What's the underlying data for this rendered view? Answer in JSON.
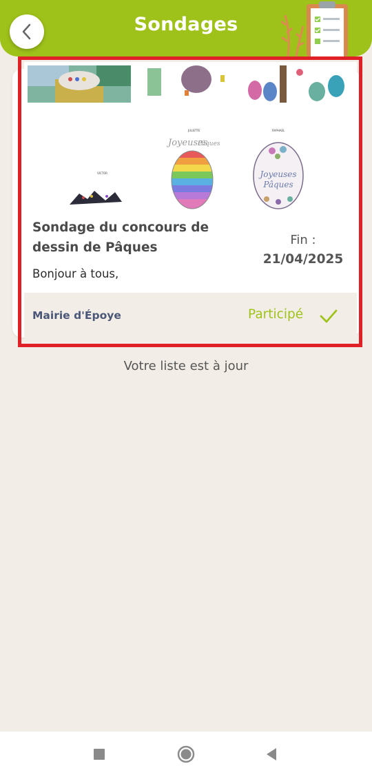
{
  "header": {
    "title": "Sondages",
    "back_icon": "chevron-left-icon",
    "decoration_icon": "clipboard-checklist-icon",
    "accent_color": "#9fc21a"
  },
  "survey": {
    "title": "Sondage du concours de dessin de Pâques",
    "description": "Bonjour à tous,",
    "end_label": "Fin :",
    "end_date": "21/04/2025",
    "author": "Mairie d'Époye",
    "status": "Participé",
    "status_icon": "check-icon",
    "artwork": {
      "names": [
        "VICTOR",
        "JULIETTE",
        "RAPHAEL"
      ],
      "egg_text_line1": "Joyeuses",
      "egg_text_line2": "Pâques"
    }
  },
  "list_status": "Votre liste est à jour",
  "system_nav": {
    "recents_icon": "square-icon",
    "home_icon": "circle-icon",
    "back_icon": "triangle-back-icon"
  },
  "colors": {
    "background": "#f2eee7",
    "highlight": "#e02027",
    "author": "#4a5677"
  }
}
